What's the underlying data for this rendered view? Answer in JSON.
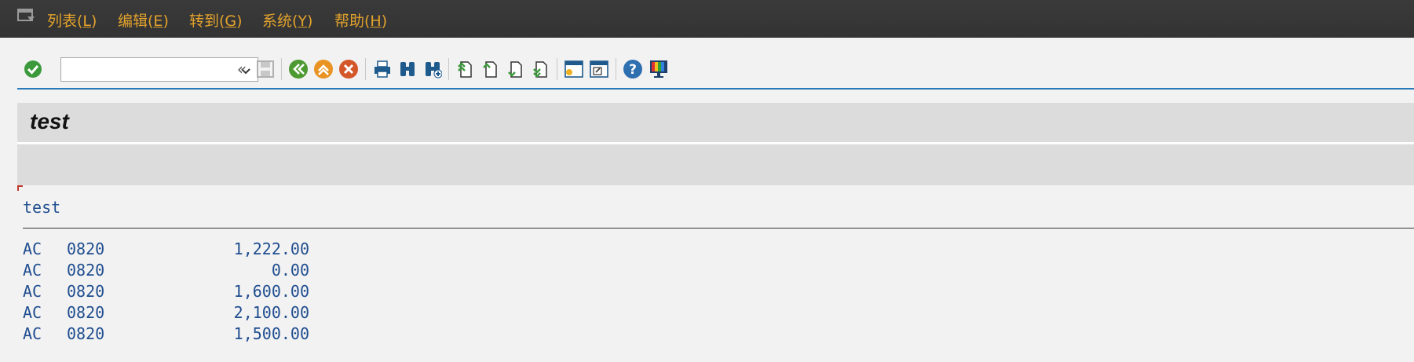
{
  "menu": {
    "items": [
      {
        "label": "列表(",
        "key": "L",
        "end": ")"
      },
      {
        "label": "编辑(",
        "key": "E",
        "end": ")"
      },
      {
        "label": "转到(",
        "key": "G",
        "end": ")"
      },
      {
        "label": "系统(",
        "key": "Y",
        "end": ")"
      },
      {
        "label": "帮助(",
        "key": "H",
        "end": ")"
      }
    ]
  },
  "toolbar": {
    "command_field_value": "",
    "expand_glyph": "«"
  },
  "colors": {
    "menu_text": "#e3a22c",
    "list_text": "#1f4d8f",
    "toolbar_line": "#2a7ab8"
  },
  "title": "test",
  "list": {
    "header": "test",
    "rows": [
      {
        "c1": "AC",
        "c2": "0820",
        "c3": "1,222.00"
      },
      {
        "c1": "AC",
        "c2": "0820",
        "c3": "0.00"
      },
      {
        "c1": "AC",
        "c2": "0820",
        "c3": "1,600.00"
      },
      {
        "c1": "AC",
        "c2": "0820",
        "c3": "2,100.00"
      },
      {
        "c1": "AC",
        "c2": "0820",
        "c3": "1,500.00"
      }
    ]
  }
}
